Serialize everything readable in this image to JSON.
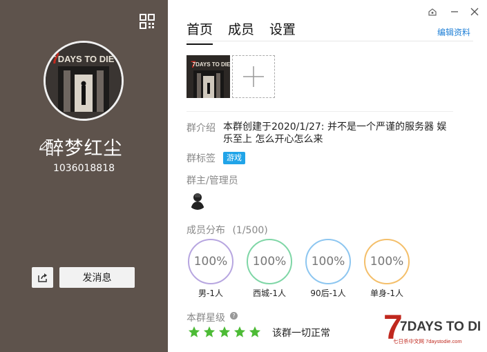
{
  "profile": {
    "name": "醉梦红尘",
    "group_number": "1036018818",
    "send_message_label": "发消息"
  },
  "tabs": [
    {
      "label": "首页",
      "active": true
    },
    {
      "label": "成员",
      "active": false
    },
    {
      "label": "设置",
      "active": false
    }
  ],
  "edit_profile_label": "编辑资料",
  "avatar_logo_text": "7DAYS TO DIE",
  "intro": {
    "label": "群介绍",
    "line1": "本群创建于2020/1/27:  并不是一个严谨的服务器 娱",
    "line2": "乐至上 怎么开心怎么来"
  },
  "tags": {
    "label": "群标签",
    "items": [
      "游戏"
    ]
  },
  "admins": {
    "label": "群主/管理员"
  },
  "distribution": {
    "label": "成员分布",
    "count": "(1/500)",
    "circles": [
      {
        "percent": "100%",
        "label": "男-1人",
        "color": "#b7a6e0"
      },
      {
        "percent": "100%",
        "label": "西城-1人",
        "color": "#7fd6a6"
      },
      {
        "percent": "100%",
        "label": "90后-1人",
        "color": "#8dc6f0"
      },
      {
        "percent": "100%",
        "label": "单身-1人",
        "color": "#f4bf6a"
      }
    ]
  },
  "rating": {
    "label": "本群星级",
    "stars": 5,
    "status": "该群一切正常",
    "star_color": "#4cbb35"
  },
  "watermark": {
    "logo": "7DAYS TO DIE",
    "sub": "七日杀中文网 7daystodie.com"
  },
  "colors": {
    "left_panel": "#5e534c",
    "link": "#1e7fd6",
    "tag": "#21a4e8"
  }
}
